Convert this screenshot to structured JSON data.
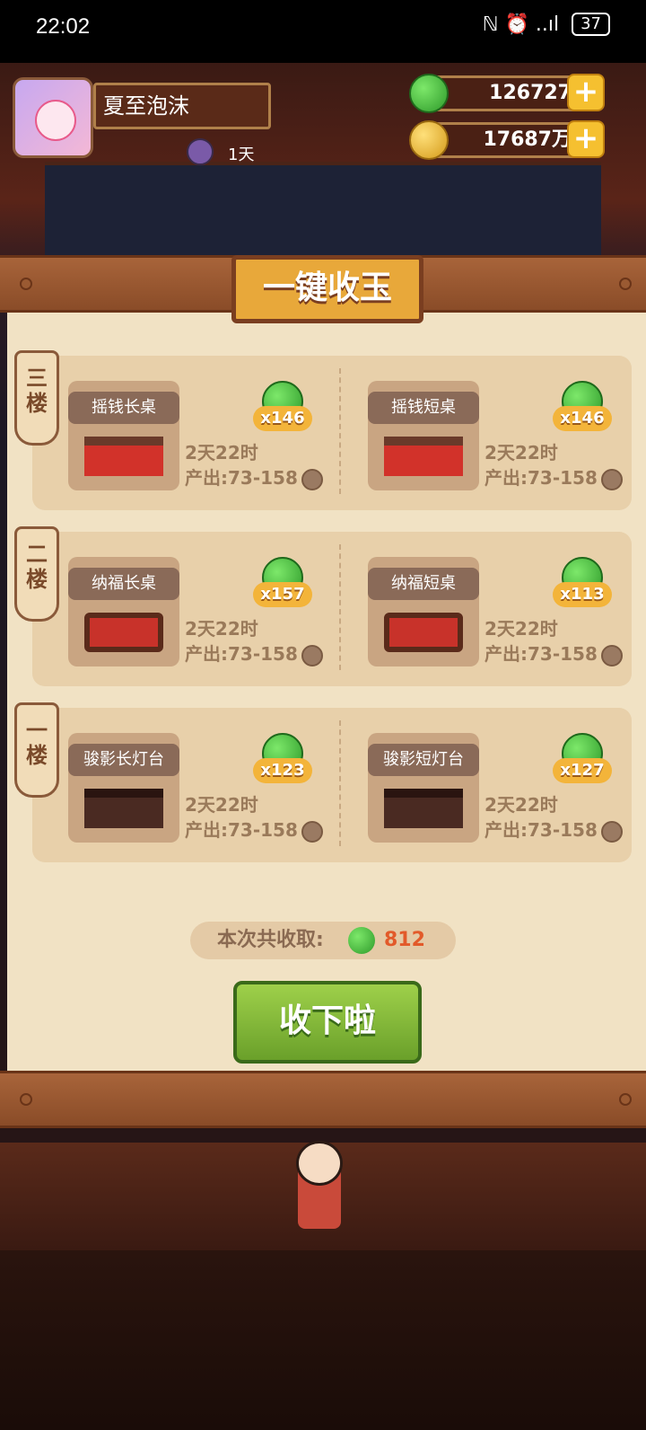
{
  "status_bar": {
    "time": "22:02",
    "icons": "ℕ ⏰ ..ıl",
    "battery": "37"
  },
  "player": {
    "name": "夏至泡沫",
    "buff_days": "1天"
  },
  "resources": {
    "jade": "126727",
    "coins": "17687万"
  },
  "dialog": {
    "title": "一键收玉",
    "floors": [
      {
        "tag": "三楼",
        "items": [
          {
            "name": "摇钱长桌",
            "count": "x146",
            "time": "2天22时",
            "output": "产出:73-158"
          },
          {
            "name": "摇钱短桌",
            "count": "x146",
            "time": "2天22时",
            "output": "产出:73-158"
          }
        ]
      },
      {
        "tag": "二楼",
        "items": [
          {
            "name": "纳福长桌",
            "count": "x157",
            "time": "2天22时",
            "output": "产出:73-158"
          },
          {
            "name": "纳福短桌",
            "count": "x113",
            "time": "2天22时",
            "output": "产出:73-158"
          }
        ]
      },
      {
        "tag": "一楼",
        "items": [
          {
            "name": "骏影长灯台",
            "count": "x123",
            "time": "2天22时",
            "output": "产出:73-158"
          },
          {
            "name": "骏影短灯台",
            "count": "x127",
            "time": "2天22时",
            "output": "产出:73-158"
          }
        ]
      }
    ],
    "total_label": "本次共收取:",
    "total_value": "812",
    "collect_button": "收下啦"
  },
  "colors": {
    "jade": "#3aa832",
    "button_green": "#8cc23c",
    "accent_orange": "#e25a2a",
    "wood": "#8a4c28"
  }
}
